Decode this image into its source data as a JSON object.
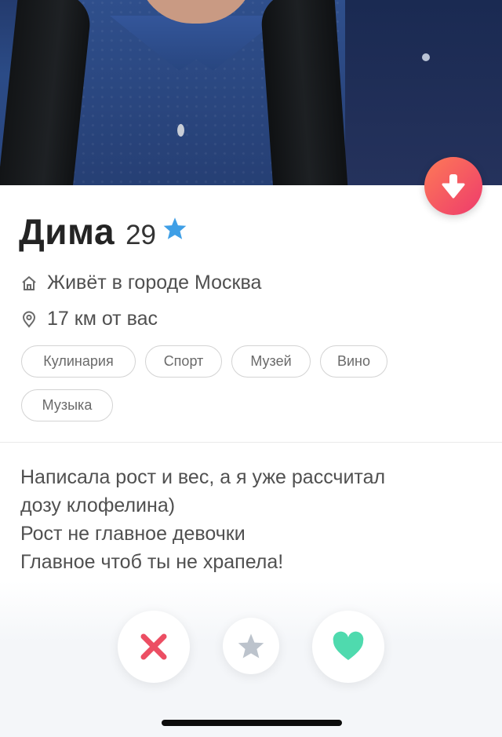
{
  "profile": {
    "name": "Дима",
    "age": "29",
    "lives_in": "Живёт в городе Москва",
    "distance": "17 км от вас"
  },
  "tags": [
    "Кулинария",
    "Спорт",
    "Музей",
    "Вино",
    "Музыка"
  ],
  "bio": [
    "Написала рост и вес, а я уже рассчитал",
    "дозу клофелина)",
    "Рост не главное девочки",
    "Главное чтоб ты не храпела!"
  ],
  "colors": {
    "accent_gradient_start": "#fd7a57",
    "accent_gradient_end": "#ee3b6c",
    "verified_blue": "#3f9fe6",
    "nope_red": "#ec4e63",
    "superlike_gray": "#bcc3cc",
    "like_green": "#4fdaae"
  },
  "icons": {
    "down": "arrow-down-icon",
    "verified": "star-icon",
    "home": "home-icon",
    "location": "location-pin-icon",
    "nope": "close-icon",
    "superlike": "star-icon",
    "like": "heart-icon"
  }
}
